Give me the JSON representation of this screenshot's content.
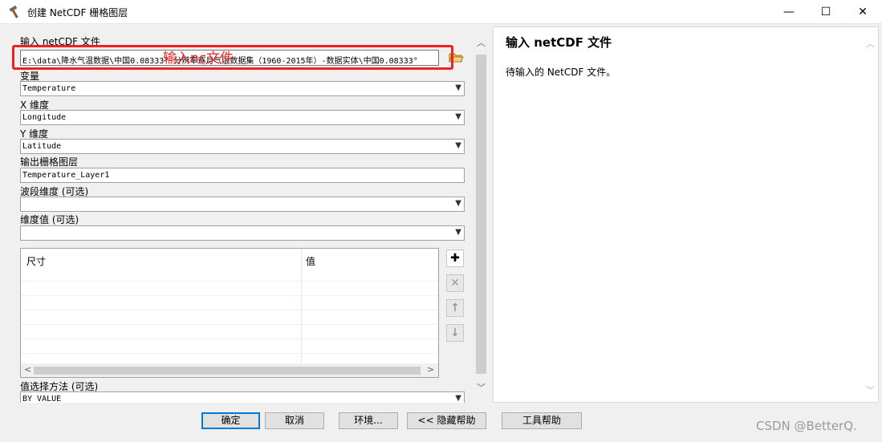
{
  "window": {
    "title": "创建 NetCDF 栅格图层",
    "minimize": "—",
    "maximize": "☐",
    "close": "✕"
  },
  "form": {
    "input_label": "输入 netCDF 文件",
    "input_value": "E:\\data\\降水气温数据\\中国0.08333° 分辨率逐月气温数据集（1960-2015年）-数据实体\\中国0.08333°",
    "variable_label": "变量",
    "variable_value": "Temperature",
    "x_label": "X 维度",
    "x_value": "Longitude",
    "y_label": "Y 维度",
    "y_value": "Latitude",
    "output_label": "输出栅格图层",
    "output_value": "Temperature_Layer1",
    "band_label": "波段维度 (可选)",
    "band_value": "",
    "dimval_label": "维度值 (可选)",
    "dimval_value": "",
    "table_headers": [
      "尺寸",
      "值"
    ],
    "valsel_label": "值选择方法 (可选)",
    "valsel_value": "BY_VALUE"
  },
  "annotation": {
    "text": "输入nc文件",
    "color": "#ee2222"
  },
  "side_buttons": [
    {
      "icon": "add-icon",
      "glyph": "✚",
      "enabled": true
    },
    {
      "icon": "delete-icon",
      "glyph": "✕",
      "enabled": false
    },
    {
      "icon": "arrow-up-icon",
      "glyph": "↑",
      "enabled": false
    },
    {
      "icon": "arrow-down-icon",
      "glyph": "↓",
      "enabled": false
    }
  ],
  "help": {
    "title": "输入 netCDF 文件",
    "body": "待输入的 NetCDF 文件。"
  },
  "buttons": {
    "ok": "确定",
    "cancel": "取消",
    "env": "环境...",
    "hide_help": "<< 隐藏帮助",
    "tool_help": "工具帮助"
  },
  "watermark": "CSDN @BetterQ."
}
